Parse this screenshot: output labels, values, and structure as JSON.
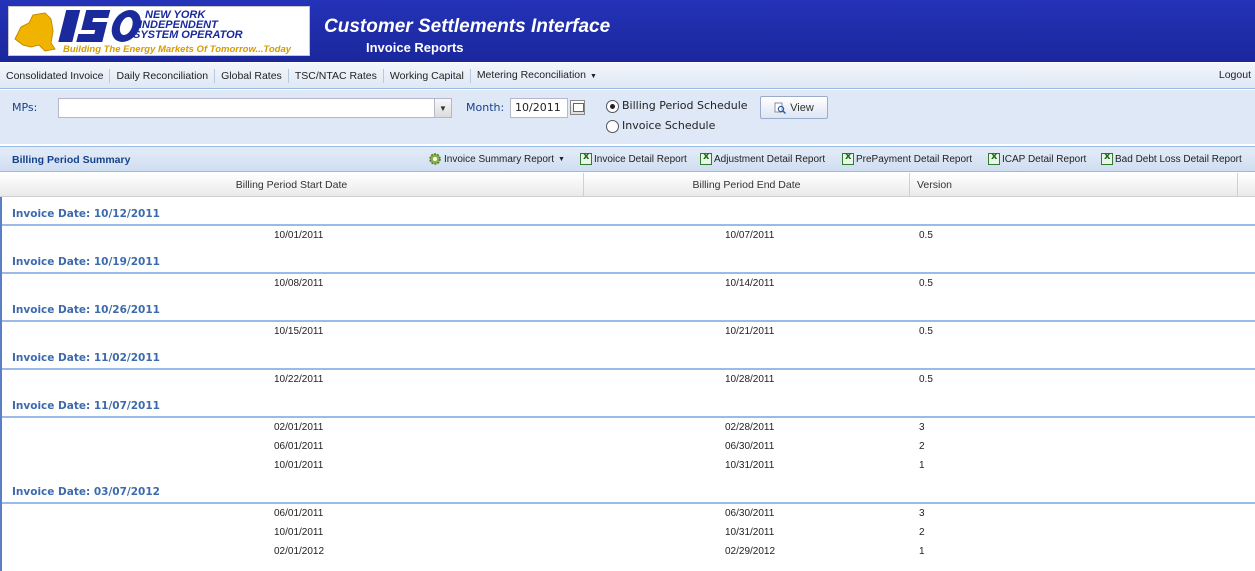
{
  "header": {
    "logo_line1": "NEW YORK",
    "logo_line2": "INDEPENDENT",
    "logo_line3": "SYSTEM OPERATOR",
    "logo_tagline": "Building The Energy Markets Of Tomorrow...Today",
    "app_title": "Customer Settlements Interface",
    "app_subtitle": "Invoice Reports"
  },
  "menu": {
    "items": [
      {
        "label": "Consolidated Invoice"
      },
      {
        "label": "Daily Reconciliation"
      },
      {
        "label": "Global Rates"
      },
      {
        "label": "TSC/NTAC Rates"
      },
      {
        "label": "Working Capital"
      },
      {
        "label": "Metering Reconciliation",
        "has_dropdown": true
      }
    ],
    "logout_label": "Logout"
  },
  "filters": {
    "mps_label": "MPs:",
    "mps_value": "",
    "month_label": "Month:",
    "month_value": "10/2011",
    "radio_billing_label": "Billing Period Schedule",
    "radio_invoice_label": "Invoice Schedule",
    "selected_schedule": "Billing Period Schedule",
    "view_label": "View"
  },
  "grid": {
    "title": "Billing Period Summary",
    "toolbar": [
      {
        "label": "Invoice Summary Report",
        "icon": "gear-icon",
        "has_dropdown": true
      },
      {
        "label": "Invoice Detail Report",
        "icon": "excel-icon"
      },
      {
        "label": "Adjustment Detail Report",
        "icon": "excel-icon"
      },
      {
        "label": "PrePayment Detail Report",
        "icon": "excel-icon"
      },
      {
        "label": "ICAP Detail Report",
        "icon": "excel-icon"
      },
      {
        "label": "Bad Debt Loss Detail Report",
        "icon": "excel-icon"
      }
    ],
    "columns": [
      "Billing Period Start Date",
      "Billing Period End Date",
      "Version"
    ],
    "groups": [
      {
        "label": "Invoice Date: 10/12/2011",
        "rows": [
          [
            "10/01/2011",
            "10/07/2011",
            "0.5"
          ]
        ]
      },
      {
        "label": "Invoice Date: 10/19/2011",
        "rows": [
          [
            "10/08/2011",
            "10/14/2011",
            "0.5"
          ]
        ]
      },
      {
        "label": "Invoice Date: 10/26/2011",
        "rows": [
          [
            "10/15/2011",
            "10/21/2011",
            "0.5"
          ]
        ]
      },
      {
        "label": "Invoice Date: 11/02/2011",
        "rows": [
          [
            "10/22/2011",
            "10/28/2011",
            "0.5"
          ]
        ]
      },
      {
        "label": "Invoice Date: 11/07/2011",
        "rows": [
          [
            "02/01/2011",
            "02/28/2011",
            "3"
          ],
          [
            "06/01/2011",
            "06/30/2011",
            "2"
          ],
          [
            "10/01/2011",
            "10/31/2011",
            "1"
          ]
        ]
      },
      {
        "label": "Invoice Date: 03/07/2012",
        "rows": [
          [
            "06/01/2011",
            "06/30/2011",
            "3"
          ],
          [
            "10/01/2011",
            "10/31/2011",
            "2"
          ],
          [
            "02/01/2012",
            "02/29/2012",
            "1"
          ]
        ]
      }
    ]
  },
  "colors": {
    "banner": "#1c2ba6",
    "accent": "#15428b",
    "group_label": "#3d6aad",
    "logo_tagline": "#d59b00"
  }
}
